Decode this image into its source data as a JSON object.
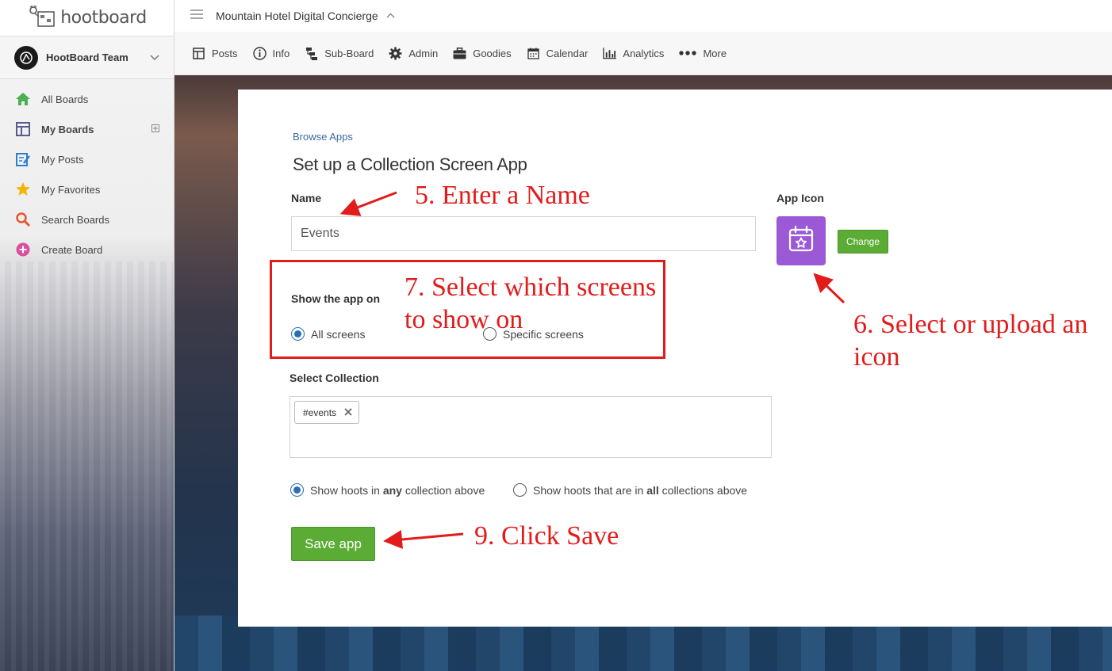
{
  "sidebar": {
    "logo_text": "hootboard",
    "team_name": "HootBoard Team",
    "items": [
      {
        "label": "All Boards",
        "icon": "home-icon",
        "bold": false
      },
      {
        "label": "My Boards",
        "icon": "boards-grid-icon",
        "bold": true
      },
      {
        "label": "My Posts",
        "icon": "edit-post-icon",
        "bold": false
      },
      {
        "label": "My Favorites",
        "icon": "star-icon",
        "bold": false
      },
      {
        "label": "Search Boards",
        "icon": "search-icon",
        "bold": false
      },
      {
        "label": "Create Board",
        "icon": "plus-circle-icon",
        "bold": false
      }
    ]
  },
  "header": {
    "board_title": "Mountain Hotel Digital Concierge",
    "tabs": [
      {
        "label": "Posts",
        "icon": "posts-icon"
      },
      {
        "label": "Info",
        "icon": "info-icon"
      },
      {
        "label": "Sub-Board",
        "icon": "sub-board-icon"
      },
      {
        "label": "Admin",
        "icon": "gear-icon"
      },
      {
        "label": "Goodies",
        "icon": "briefcase-icon"
      },
      {
        "label": "Calendar",
        "icon": "calendar-icon"
      },
      {
        "label": "Analytics",
        "icon": "bar-chart-icon"
      },
      {
        "label": "More",
        "icon": "more-dots-icon"
      }
    ]
  },
  "panel": {
    "browse_link": "Browse Apps",
    "title": "Set up a Collection Screen App",
    "name_label": "Name",
    "name_value": "Events",
    "app_icon_label": "App Icon",
    "change_label": "Change",
    "show_on_label": "Show the app on",
    "show_on_options": [
      "All screens",
      "Specific screens"
    ],
    "show_on_selected": "All screens",
    "collection_label": "Select Collection",
    "collection_tags": [
      "#events"
    ],
    "match_any_prefix": "Show hoots in ",
    "match_any_bold": "any",
    "match_any_suffix": " collection above",
    "match_all_prefix": "Show hoots that are in ",
    "match_all_bold": "all",
    "match_all_suffix": " collections above",
    "match_selected": "any",
    "save_label": "Save app"
  },
  "annotations": {
    "step5": "5. Enter a Name",
    "step6_line1": "6. Select or upload an",
    "step6_line2": "icon",
    "step7_line1": "7. Select which screens",
    "step7_line2": "to show on",
    "step9": "9. Click Save",
    "color": "#e21b1b"
  },
  "colors": {
    "accent_green": "#5aac34",
    "app_icon_purple": "#9b59d6",
    "link_blue": "#3a6c9e"
  }
}
